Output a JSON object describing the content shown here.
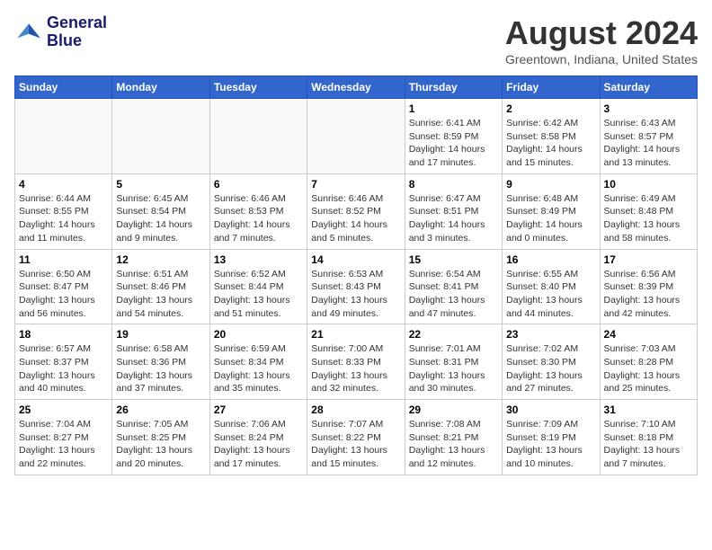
{
  "logo": {
    "line1": "General",
    "line2": "Blue"
  },
  "title": "August 2024",
  "subtitle": "Greentown, Indiana, United States",
  "weekdays": [
    "Sunday",
    "Monday",
    "Tuesday",
    "Wednesday",
    "Thursday",
    "Friday",
    "Saturday"
  ],
  "weeks": [
    [
      {
        "day": "",
        "info": ""
      },
      {
        "day": "",
        "info": ""
      },
      {
        "day": "",
        "info": ""
      },
      {
        "day": "",
        "info": ""
      },
      {
        "day": "1",
        "info": "Sunrise: 6:41 AM\nSunset: 8:59 PM\nDaylight: 14 hours and 17 minutes."
      },
      {
        "day": "2",
        "info": "Sunrise: 6:42 AM\nSunset: 8:58 PM\nDaylight: 14 hours and 15 minutes."
      },
      {
        "day": "3",
        "info": "Sunrise: 6:43 AM\nSunset: 8:57 PM\nDaylight: 14 hours and 13 minutes."
      }
    ],
    [
      {
        "day": "4",
        "info": "Sunrise: 6:44 AM\nSunset: 8:55 PM\nDaylight: 14 hours and 11 minutes."
      },
      {
        "day": "5",
        "info": "Sunrise: 6:45 AM\nSunset: 8:54 PM\nDaylight: 14 hours and 9 minutes."
      },
      {
        "day": "6",
        "info": "Sunrise: 6:46 AM\nSunset: 8:53 PM\nDaylight: 14 hours and 7 minutes."
      },
      {
        "day": "7",
        "info": "Sunrise: 6:46 AM\nSunset: 8:52 PM\nDaylight: 14 hours and 5 minutes."
      },
      {
        "day": "8",
        "info": "Sunrise: 6:47 AM\nSunset: 8:51 PM\nDaylight: 14 hours and 3 minutes."
      },
      {
        "day": "9",
        "info": "Sunrise: 6:48 AM\nSunset: 8:49 PM\nDaylight: 14 hours and 0 minutes."
      },
      {
        "day": "10",
        "info": "Sunrise: 6:49 AM\nSunset: 8:48 PM\nDaylight: 13 hours and 58 minutes."
      }
    ],
    [
      {
        "day": "11",
        "info": "Sunrise: 6:50 AM\nSunset: 8:47 PM\nDaylight: 13 hours and 56 minutes."
      },
      {
        "day": "12",
        "info": "Sunrise: 6:51 AM\nSunset: 8:46 PM\nDaylight: 13 hours and 54 minutes."
      },
      {
        "day": "13",
        "info": "Sunrise: 6:52 AM\nSunset: 8:44 PM\nDaylight: 13 hours and 51 minutes."
      },
      {
        "day": "14",
        "info": "Sunrise: 6:53 AM\nSunset: 8:43 PM\nDaylight: 13 hours and 49 minutes."
      },
      {
        "day": "15",
        "info": "Sunrise: 6:54 AM\nSunset: 8:41 PM\nDaylight: 13 hours and 47 minutes."
      },
      {
        "day": "16",
        "info": "Sunrise: 6:55 AM\nSunset: 8:40 PM\nDaylight: 13 hours and 44 minutes."
      },
      {
        "day": "17",
        "info": "Sunrise: 6:56 AM\nSunset: 8:39 PM\nDaylight: 13 hours and 42 minutes."
      }
    ],
    [
      {
        "day": "18",
        "info": "Sunrise: 6:57 AM\nSunset: 8:37 PM\nDaylight: 13 hours and 40 minutes."
      },
      {
        "day": "19",
        "info": "Sunrise: 6:58 AM\nSunset: 8:36 PM\nDaylight: 13 hours and 37 minutes."
      },
      {
        "day": "20",
        "info": "Sunrise: 6:59 AM\nSunset: 8:34 PM\nDaylight: 13 hours and 35 minutes."
      },
      {
        "day": "21",
        "info": "Sunrise: 7:00 AM\nSunset: 8:33 PM\nDaylight: 13 hours and 32 minutes."
      },
      {
        "day": "22",
        "info": "Sunrise: 7:01 AM\nSunset: 8:31 PM\nDaylight: 13 hours and 30 minutes."
      },
      {
        "day": "23",
        "info": "Sunrise: 7:02 AM\nSunset: 8:30 PM\nDaylight: 13 hours and 27 minutes."
      },
      {
        "day": "24",
        "info": "Sunrise: 7:03 AM\nSunset: 8:28 PM\nDaylight: 13 hours and 25 minutes."
      }
    ],
    [
      {
        "day": "25",
        "info": "Sunrise: 7:04 AM\nSunset: 8:27 PM\nDaylight: 13 hours and 22 minutes."
      },
      {
        "day": "26",
        "info": "Sunrise: 7:05 AM\nSunset: 8:25 PM\nDaylight: 13 hours and 20 minutes."
      },
      {
        "day": "27",
        "info": "Sunrise: 7:06 AM\nSunset: 8:24 PM\nDaylight: 13 hours and 17 minutes."
      },
      {
        "day": "28",
        "info": "Sunrise: 7:07 AM\nSunset: 8:22 PM\nDaylight: 13 hours and 15 minutes."
      },
      {
        "day": "29",
        "info": "Sunrise: 7:08 AM\nSunset: 8:21 PM\nDaylight: 13 hours and 12 minutes."
      },
      {
        "day": "30",
        "info": "Sunrise: 7:09 AM\nSunset: 8:19 PM\nDaylight: 13 hours and 10 minutes."
      },
      {
        "day": "31",
        "info": "Sunrise: 7:10 AM\nSunset: 8:18 PM\nDaylight: 13 hours and 7 minutes."
      }
    ]
  ]
}
